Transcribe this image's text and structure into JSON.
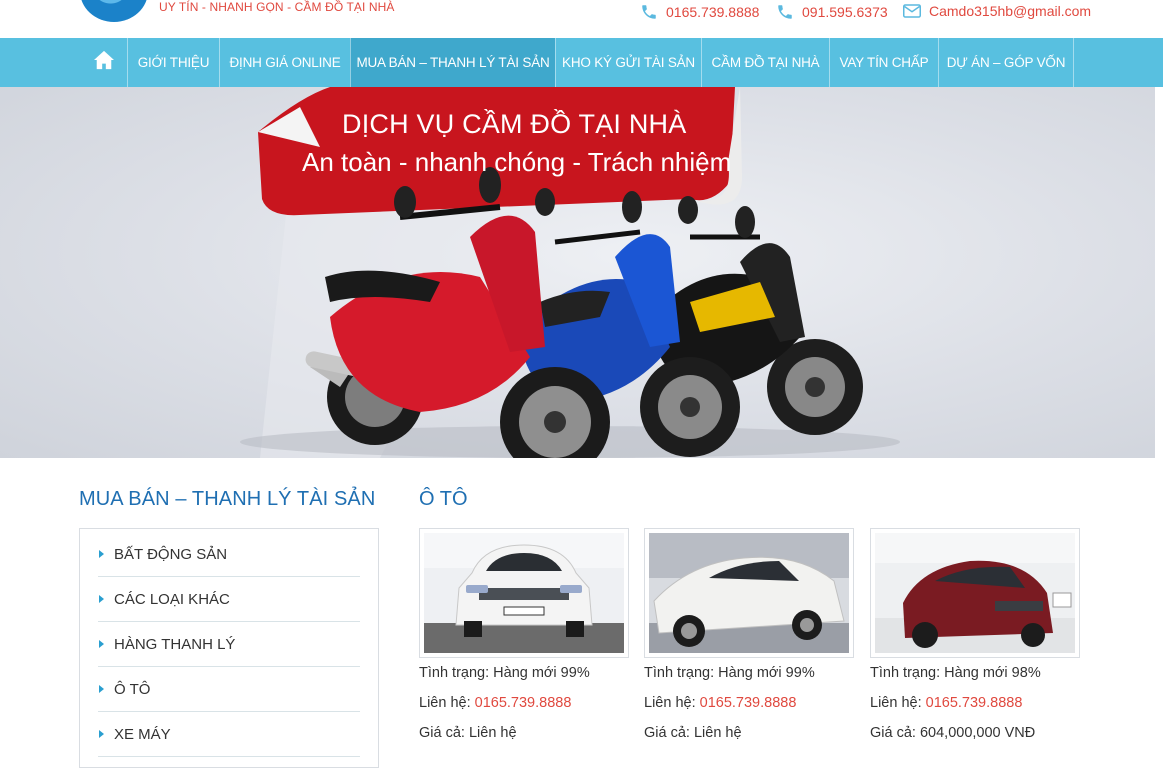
{
  "header": {
    "slogan": "UY TÍN - NHANH GỌN - CẦM ĐỒ TẠI NHÀ",
    "phone1": "0165.739.8888",
    "phone2": "091.595.6373",
    "email": "Camdo315hb@gmail.com",
    "icons": [
      "phone-icon",
      "phone-icon",
      "mail-icon"
    ]
  },
  "nav": {
    "home_icon": "home-icon",
    "items": [
      {
        "label": "GIỚI THIỆU"
      },
      {
        "label": "ĐỊNH GIÁ ONLINE"
      },
      {
        "label": "MUA BÁN – THANH LÝ TÀI SẢN",
        "active": true
      },
      {
        "label": "KHO KÝ GỬI TÀI SẢN"
      },
      {
        "label": "CẦM ĐỒ TẠI NHÀ"
      },
      {
        "label": "VAY TÍN CHẤP"
      },
      {
        "label": "DỰ ÁN – GÓP VỐN"
      }
    ]
  },
  "banner": {
    "title": "DỊCH VỤ CẦM ĐỒ TẠI NHÀ",
    "subtitle": "An toàn - nhanh chóng - Trách nhiệm"
  },
  "sidebar": {
    "title": "MUA BÁN – THANH LÝ TÀI SẢN",
    "items": [
      {
        "label": "BẤT ĐỘNG SẢN"
      },
      {
        "label": "CÁC LOẠI KHÁC"
      },
      {
        "label": "HÀNG THANH LÝ"
      },
      {
        "label": "Ô TÔ"
      },
      {
        "label": "XE MÁY"
      }
    ]
  },
  "main": {
    "title": "Ô TÔ",
    "products": [
      {
        "status_label": "Tình trạng: ",
        "status": "Hàng mới 99%",
        "contact_label": "Liên hệ: ",
        "contact": "0165.739.8888",
        "price_label": "Giá cả: ",
        "price": "Liên hệ"
      },
      {
        "status_label": "Tình trạng: ",
        "status": "Hàng mới 99%",
        "contact_label": "Liên hệ: ",
        "contact": "0165.739.8888",
        "price_label": "Giá cả: ",
        "price": "Liên hệ"
      },
      {
        "status_label": "Tình trạng: ",
        "status": "Hàng mới 98%",
        "contact_label": "Liên hệ: ",
        "contact": "0165.739.8888",
        "price_label": "Giá cả: ",
        "price": "604,000,000 VNĐ"
      }
    ]
  },
  "colors": {
    "nav_bg": "#58c0e0",
    "nav_active": "#3fa8cc",
    "accent_red": "#e0493f",
    "title_blue": "#1f6fb2"
  }
}
